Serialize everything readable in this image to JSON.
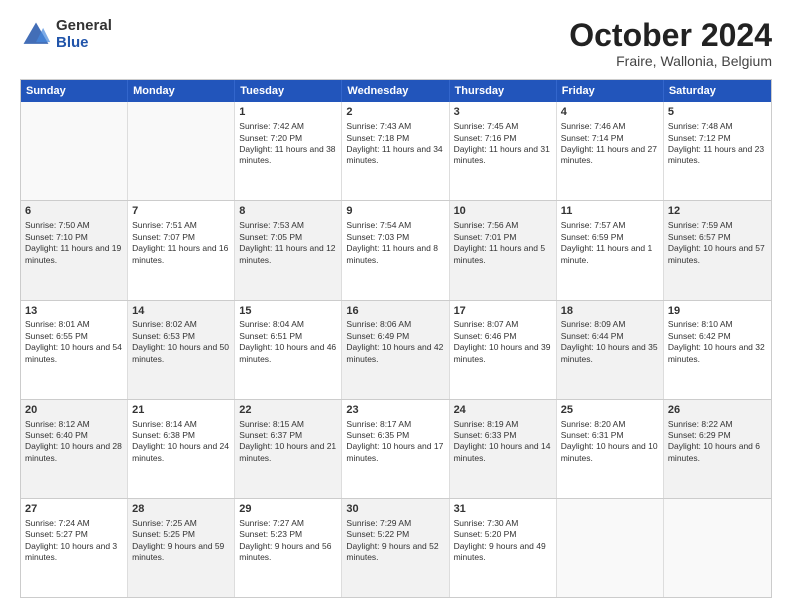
{
  "logo": {
    "general": "General",
    "blue": "Blue"
  },
  "title": {
    "month": "October 2024",
    "location": "Fraire, Wallonia, Belgium"
  },
  "header_days": [
    "Sunday",
    "Monday",
    "Tuesday",
    "Wednesday",
    "Thursday",
    "Friday",
    "Saturday"
  ],
  "weeks": [
    [
      {
        "day": "",
        "info": "",
        "empty": true
      },
      {
        "day": "",
        "info": "",
        "empty": true
      },
      {
        "day": "1",
        "info": "Sunrise: 7:42 AM\nSunset: 7:20 PM\nDaylight: 11 hours and 38 minutes."
      },
      {
        "day": "2",
        "info": "Sunrise: 7:43 AM\nSunset: 7:18 PM\nDaylight: 11 hours and 34 minutes."
      },
      {
        "day": "3",
        "info": "Sunrise: 7:45 AM\nSunset: 7:16 PM\nDaylight: 11 hours and 31 minutes."
      },
      {
        "day": "4",
        "info": "Sunrise: 7:46 AM\nSunset: 7:14 PM\nDaylight: 11 hours and 27 minutes."
      },
      {
        "day": "5",
        "info": "Sunrise: 7:48 AM\nSunset: 7:12 PM\nDaylight: 11 hours and 23 minutes."
      }
    ],
    [
      {
        "day": "6",
        "info": "Sunrise: 7:50 AM\nSunset: 7:10 PM\nDaylight: 11 hours and 19 minutes.",
        "shaded": true
      },
      {
        "day": "7",
        "info": "Sunrise: 7:51 AM\nSunset: 7:07 PM\nDaylight: 11 hours and 16 minutes."
      },
      {
        "day": "8",
        "info": "Sunrise: 7:53 AM\nSunset: 7:05 PM\nDaylight: 11 hours and 12 minutes.",
        "shaded": true
      },
      {
        "day": "9",
        "info": "Sunrise: 7:54 AM\nSunset: 7:03 PM\nDaylight: 11 hours and 8 minutes."
      },
      {
        "day": "10",
        "info": "Sunrise: 7:56 AM\nSunset: 7:01 PM\nDaylight: 11 hours and 5 minutes.",
        "shaded": true
      },
      {
        "day": "11",
        "info": "Sunrise: 7:57 AM\nSunset: 6:59 PM\nDaylight: 11 hours and 1 minute."
      },
      {
        "day": "12",
        "info": "Sunrise: 7:59 AM\nSunset: 6:57 PM\nDaylight: 10 hours and 57 minutes.",
        "shaded": true
      }
    ],
    [
      {
        "day": "13",
        "info": "Sunrise: 8:01 AM\nSunset: 6:55 PM\nDaylight: 10 hours and 54 minutes."
      },
      {
        "day": "14",
        "info": "Sunrise: 8:02 AM\nSunset: 6:53 PM\nDaylight: 10 hours and 50 minutes.",
        "shaded": true
      },
      {
        "day": "15",
        "info": "Sunrise: 8:04 AM\nSunset: 6:51 PM\nDaylight: 10 hours and 46 minutes."
      },
      {
        "day": "16",
        "info": "Sunrise: 8:06 AM\nSunset: 6:49 PM\nDaylight: 10 hours and 42 minutes.",
        "shaded": true
      },
      {
        "day": "17",
        "info": "Sunrise: 8:07 AM\nSunset: 6:46 PM\nDaylight: 10 hours and 39 minutes."
      },
      {
        "day": "18",
        "info": "Sunrise: 8:09 AM\nSunset: 6:44 PM\nDaylight: 10 hours and 35 minutes.",
        "shaded": true
      },
      {
        "day": "19",
        "info": "Sunrise: 8:10 AM\nSunset: 6:42 PM\nDaylight: 10 hours and 32 minutes."
      }
    ],
    [
      {
        "day": "20",
        "info": "Sunrise: 8:12 AM\nSunset: 6:40 PM\nDaylight: 10 hours and 28 minutes.",
        "shaded": true
      },
      {
        "day": "21",
        "info": "Sunrise: 8:14 AM\nSunset: 6:38 PM\nDaylight: 10 hours and 24 minutes."
      },
      {
        "day": "22",
        "info": "Sunrise: 8:15 AM\nSunset: 6:37 PM\nDaylight: 10 hours and 21 minutes.",
        "shaded": true
      },
      {
        "day": "23",
        "info": "Sunrise: 8:17 AM\nSunset: 6:35 PM\nDaylight: 10 hours and 17 minutes."
      },
      {
        "day": "24",
        "info": "Sunrise: 8:19 AM\nSunset: 6:33 PM\nDaylight: 10 hours and 14 minutes.",
        "shaded": true
      },
      {
        "day": "25",
        "info": "Sunrise: 8:20 AM\nSunset: 6:31 PM\nDaylight: 10 hours and 10 minutes."
      },
      {
        "day": "26",
        "info": "Sunrise: 8:22 AM\nSunset: 6:29 PM\nDaylight: 10 hours and 6 minutes.",
        "shaded": true
      }
    ],
    [
      {
        "day": "27",
        "info": "Sunrise: 7:24 AM\nSunset: 5:27 PM\nDaylight: 10 hours and 3 minutes."
      },
      {
        "day": "28",
        "info": "Sunrise: 7:25 AM\nSunset: 5:25 PM\nDaylight: 9 hours and 59 minutes.",
        "shaded": true
      },
      {
        "day": "29",
        "info": "Sunrise: 7:27 AM\nSunset: 5:23 PM\nDaylight: 9 hours and 56 minutes."
      },
      {
        "day": "30",
        "info": "Sunrise: 7:29 AM\nSunset: 5:22 PM\nDaylight: 9 hours and 52 minutes.",
        "shaded": true
      },
      {
        "day": "31",
        "info": "Sunrise: 7:30 AM\nSunset: 5:20 PM\nDaylight: 9 hours and 49 minutes."
      },
      {
        "day": "",
        "info": "",
        "empty": true
      },
      {
        "day": "",
        "info": "",
        "empty": true
      }
    ]
  ]
}
